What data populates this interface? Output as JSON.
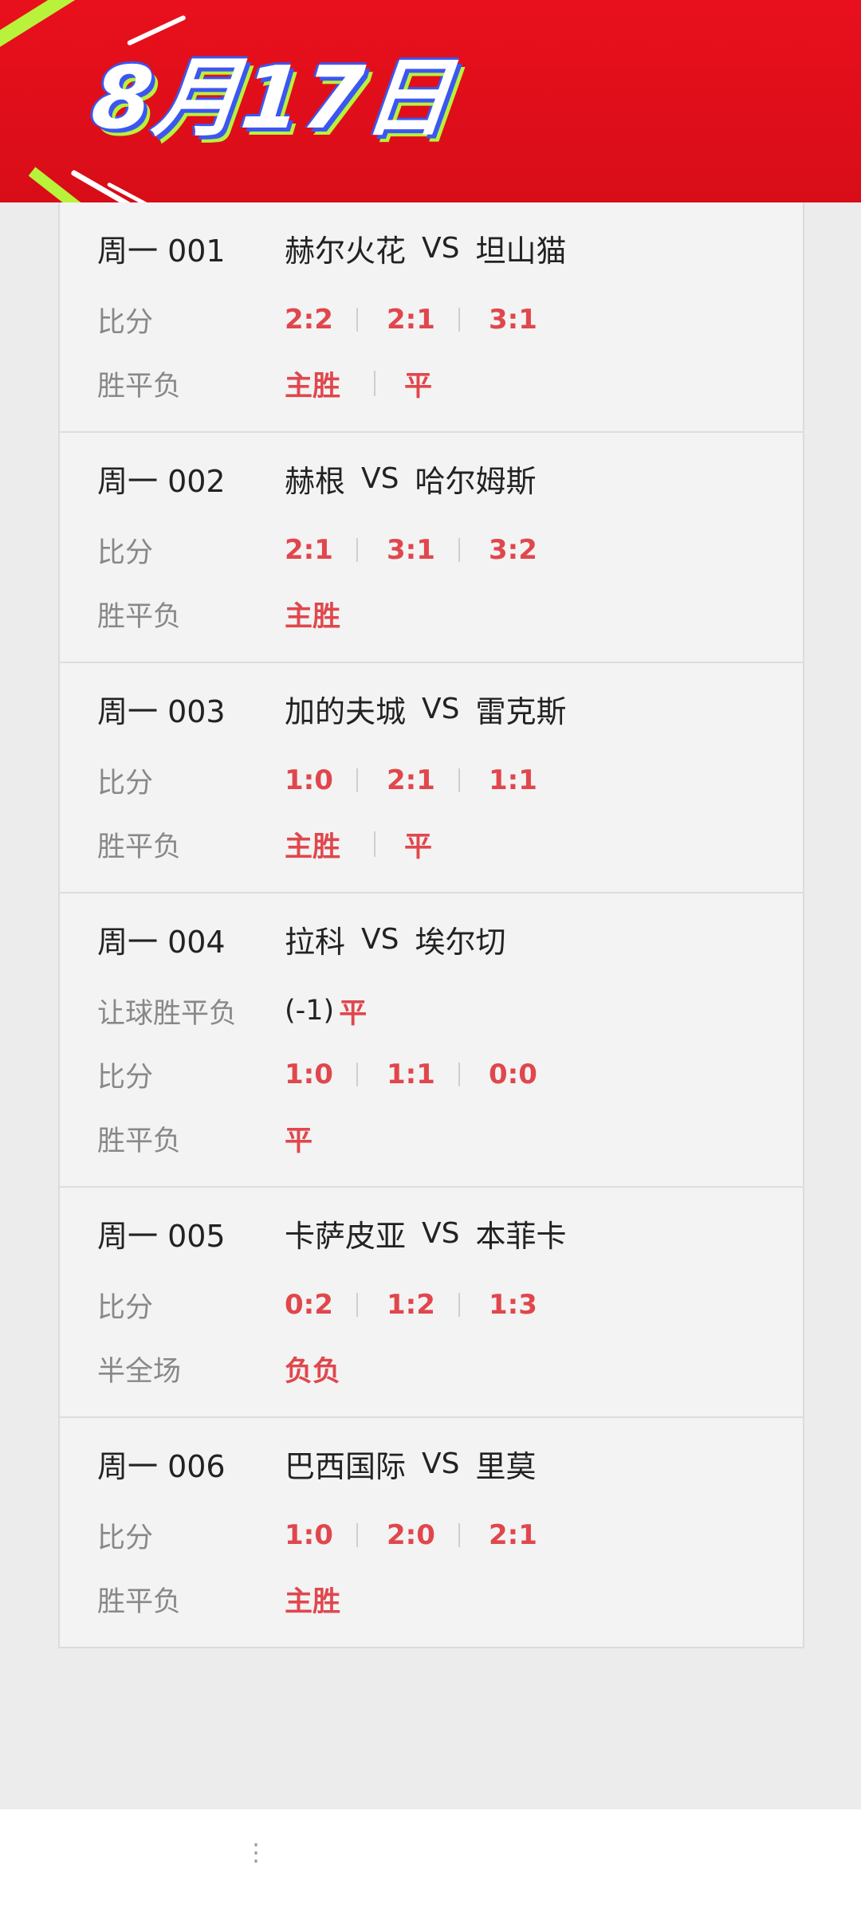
{
  "header": {
    "date": "8月17日"
  },
  "labels": {
    "score": "比分",
    "wdl": "胜平负",
    "handicap_wdl": "让球胜平负",
    "half_full": "半全场"
  },
  "vs": "VS",
  "matches": [
    {
      "code": "周一 001",
      "home": "赫尔火花",
      "away": "坦山猫",
      "scores": [
        "2:2",
        "2:1",
        "3:1"
      ],
      "results": [
        "主胜",
        "平"
      ]
    },
    {
      "code": "周一 002",
      "home": "赫根",
      "away": "哈尔姆斯",
      "scores": [
        "2:1",
        "3:1",
        "3:2"
      ],
      "results": [
        "主胜"
      ]
    },
    {
      "code": "周一 003",
      "home": "加的夫城",
      "away": "雷克斯",
      "scores": [
        "1:0",
        "2:1",
        "1:1"
      ],
      "results": [
        "主胜",
        "平"
      ]
    },
    {
      "code": "周一 004",
      "home": "拉科",
      "away": "埃尔切",
      "handicap": "(-1)",
      "handicap_result": "平",
      "scores": [
        "1:0",
        "1:1",
        "0:0"
      ],
      "results": [
        "平"
      ]
    },
    {
      "code": "周一 005",
      "home": "卡萨皮亚",
      "away": "本菲卡",
      "scores": [
        "0:2",
        "1:2",
        "1:3"
      ],
      "half_full": "负负"
    },
    {
      "code": "周一 006",
      "home": "巴西国际",
      "away": "里莫",
      "scores": [
        "1:0",
        "2:0",
        "2:1"
      ],
      "results": [
        "主胜"
      ]
    }
  ],
  "footer": {
    "dots": "⋮"
  },
  "colors": {
    "banner": "#e8101c",
    "accent": "#e0474d",
    "title_blue": "#3b57f0",
    "title_green": "#b8f23a"
  }
}
